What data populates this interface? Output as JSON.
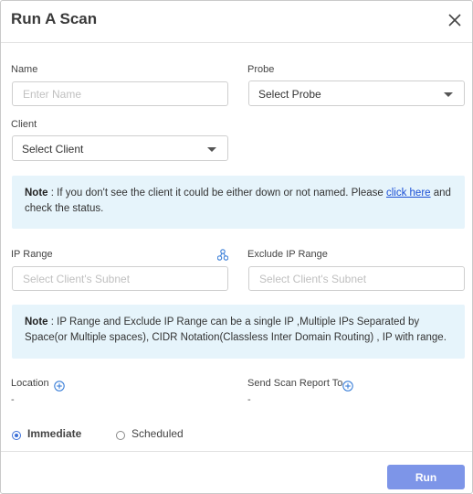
{
  "dialog": {
    "title": "Run A Scan",
    "close_icon": "close-icon"
  },
  "form": {
    "name": {
      "label": "Name",
      "placeholder": "Enter Name",
      "value": ""
    },
    "probe": {
      "label": "Probe",
      "selected": "Select Probe"
    },
    "client": {
      "label": "Client",
      "selected": "Select Client"
    },
    "ip_range": {
      "label": "IP Range",
      "placeholder": "Select Client's Subnet",
      "icon": "network-icon"
    },
    "exclude_ip_range": {
      "label": "Exclude IP Range",
      "placeholder": "Select Client's Subnet"
    },
    "location": {
      "label": "Location",
      "value": "-",
      "icon": "add-circle-icon"
    },
    "send_report": {
      "label": "Send Scan Report To",
      "value": "-",
      "icon": "add-circle-icon"
    }
  },
  "notes": {
    "client_note": {
      "prefix": "Note",
      "text_before": " : If you don't see the client it could be either down or not named. Please ",
      "link": "click here",
      "text_after": " and check the status."
    },
    "ip_note": {
      "prefix": "Note",
      "text": " : IP Range and Exclude IP Range can be a single IP ,Multiple IPs Separated by Space(or Multiple spaces), CIDR Notation(Classless Inter Domain Routing) , IP with range."
    }
  },
  "schedule": {
    "options": [
      {
        "label": "Immediate",
        "checked": true
      },
      {
        "label": "Scheduled",
        "checked": false
      }
    ]
  },
  "footer": {
    "run_label": "Run"
  },
  "colors": {
    "accent": "#3b6fd8",
    "run_button": "#7d95e8",
    "note_bg": "#e6f4fb",
    "link": "#1a4fd6"
  }
}
